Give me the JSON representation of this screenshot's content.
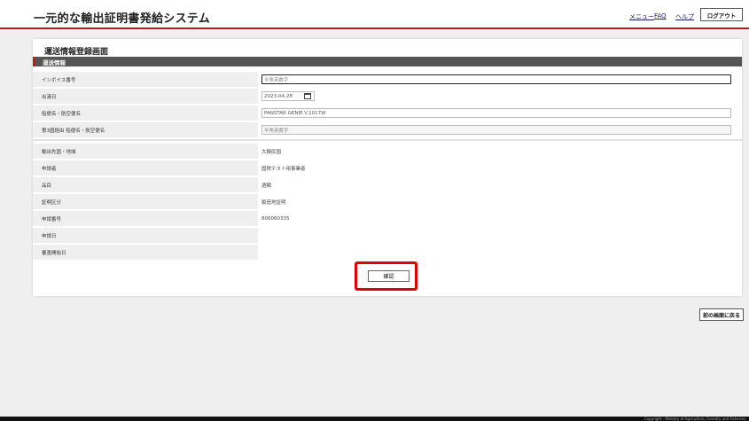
{
  "header": {
    "title": "一元的な輸出証明書発給システム",
    "menu_label": "メニュー",
    "faq_label": "FAQ",
    "help_label": "ヘルプ",
    "logout_label": "ログアウト",
    "accent_color": "#c8161d"
  },
  "form": {
    "page_title": "運送情報登録画面",
    "section_title": "運送情報",
    "fields": [
      {
        "label": "インボイス番号",
        "placeholder": "半角英数字",
        "value": ""
      },
      {
        "label": "出港日",
        "value": "2023-04-28"
      },
      {
        "label": "船便名・航空便名",
        "value": "PANSTAR GENIE V.1017W"
      },
      {
        "label": "第3国経由 船便名・航空便名",
        "placeholder": "半角英数字",
        "value": ""
      }
    ],
    "info_rows": [
      {
        "label": "輸出先国・地域",
        "value": "大韓民国"
      },
      {
        "label": "申請者",
        "value": "国税テスト用事業者"
      },
      {
        "label": "品目",
        "value": "酒類"
      },
      {
        "label": "証明区分",
        "value": "製造地証明"
      },
      {
        "label": "申請番号",
        "value": "800060335"
      },
      {
        "label": "申請日",
        "value": ""
      },
      {
        "label": "審査開始日",
        "value": ""
      }
    ],
    "confirm_label": "確認"
  },
  "back_label": "前の画面に戻る",
  "footer": {
    "copyright": "Copyright · Ministry of Agriculture, Forestry and Fisheries"
  }
}
